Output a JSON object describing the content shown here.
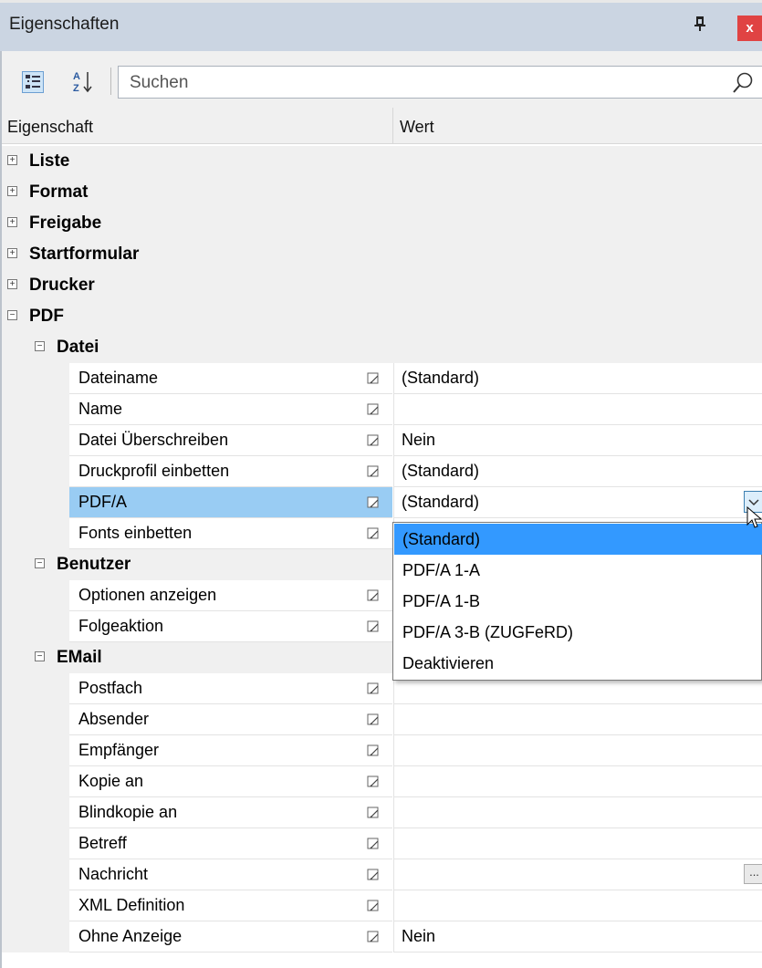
{
  "window": {
    "title": "Eigenschaften",
    "pin_glyph": "ᵖ",
    "close_glyph": "x"
  },
  "toolbar": {
    "categorized_icon": "categorized-view-icon",
    "alpha_icon": "sort-alphabetical-icon",
    "search_placeholder": "Suchen",
    "search_icon": "magnifier-icon"
  },
  "columns": {
    "property": "Eigenschaft",
    "value": "Wert"
  },
  "rows": [
    {
      "kind": "cat",
      "label": "Liste",
      "expander": "+"
    },
    {
      "kind": "cat",
      "label": "Format",
      "expander": "+"
    },
    {
      "kind": "cat",
      "label": "Freigabe",
      "expander": "+"
    },
    {
      "kind": "cat",
      "label": "Startformular",
      "expander": "+"
    },
    {
      "kind": "cat",
      "label": "Drucker",
      "expander": "+"
    },
    {
      "kind": "cat",
      "label": "PDF",
      "expander": "−"
    },
    {
      "kind": "sub",
      "label": "Datei",
      "expander": "−"
    },
    {
      "kind": "prop",
      "label": "Dateiname",
      "value": "(Standard)"
    },
    {
      "kind": "prop",
      "label": "Name",
      "value": ""
    },
    {
      "kind": "prop",
      "label": "Datei Überschreiben",
      "value": "Nein"
    },
    {
      "kind": "prop",
      "label": "Druckprofil einbetten",
      "value": "(Standard)"
    },
    {
      "kind": "prop",
      "label": "PDF/A",
      "value": "(Standard)",
      "selected": true,
      "dropdown": true
    },
    {
      "kind": "prop",
      "label": "Fonts einbetten",
      "value": ""
    },
    {
      "kind": "sub",
      "label": "Benutzer",
      "expander": "−"
    },
    {
      "kind": "prop",
      "label": "Optionen anzeigen",
      "value": ""
    },
    {
      "kind": "prop",
      "label": "Folgeaktion",
      "value": ""
    },
    {
      "kind": "sub",
      "label": "EMail",
      "expander": "−"
    },
    {
      "kind": "prop",
      "label": "Postfach",
      "value": ""
    },
    {
      "kind": "prop",
      "label": "Absender",
      "value": ""
    },
    {
      "kind": "prop",
      "label": "Empfänger",
      "value": ""
    },
    {
      "kind": "prop",
      "label": "Kopie an",
      "value": ""
    },
    {
      "kind": "prop",
      "label": "Blindkopie an",
      "value": ""
    },
    {
      "kind": "prop",
      "label": "Betreff",
      "value": ""
    },
    {
      "kind": "prop",
      "label": "Nachricht",
      "value": "",
      "ellipsis": "..."
    },
    {
      "kind": "prop",
      "label": "XML Definition",
      "value": ""
    },
    {
      "kind": "prop",
      "label": "Ohne Anzeige",
      "value": "Nein"
    }
  ],
  "dropdown": {
    "selected": "(Standard)",
    "options": [
      "(Standard)",
      "PDF/A 1-A",
      "PDF/A 1-B",
      "PDF/A 3-B (ZUGFeRD)",
      "Deaktivieren"
    ]
  },
  "colors": {
    "titlebar": "#cbd5e2",
    "selection": "#99ccf3",
    "dropdown_highlight": "#3399ff",
    "close": "#e04343"
  }
}
